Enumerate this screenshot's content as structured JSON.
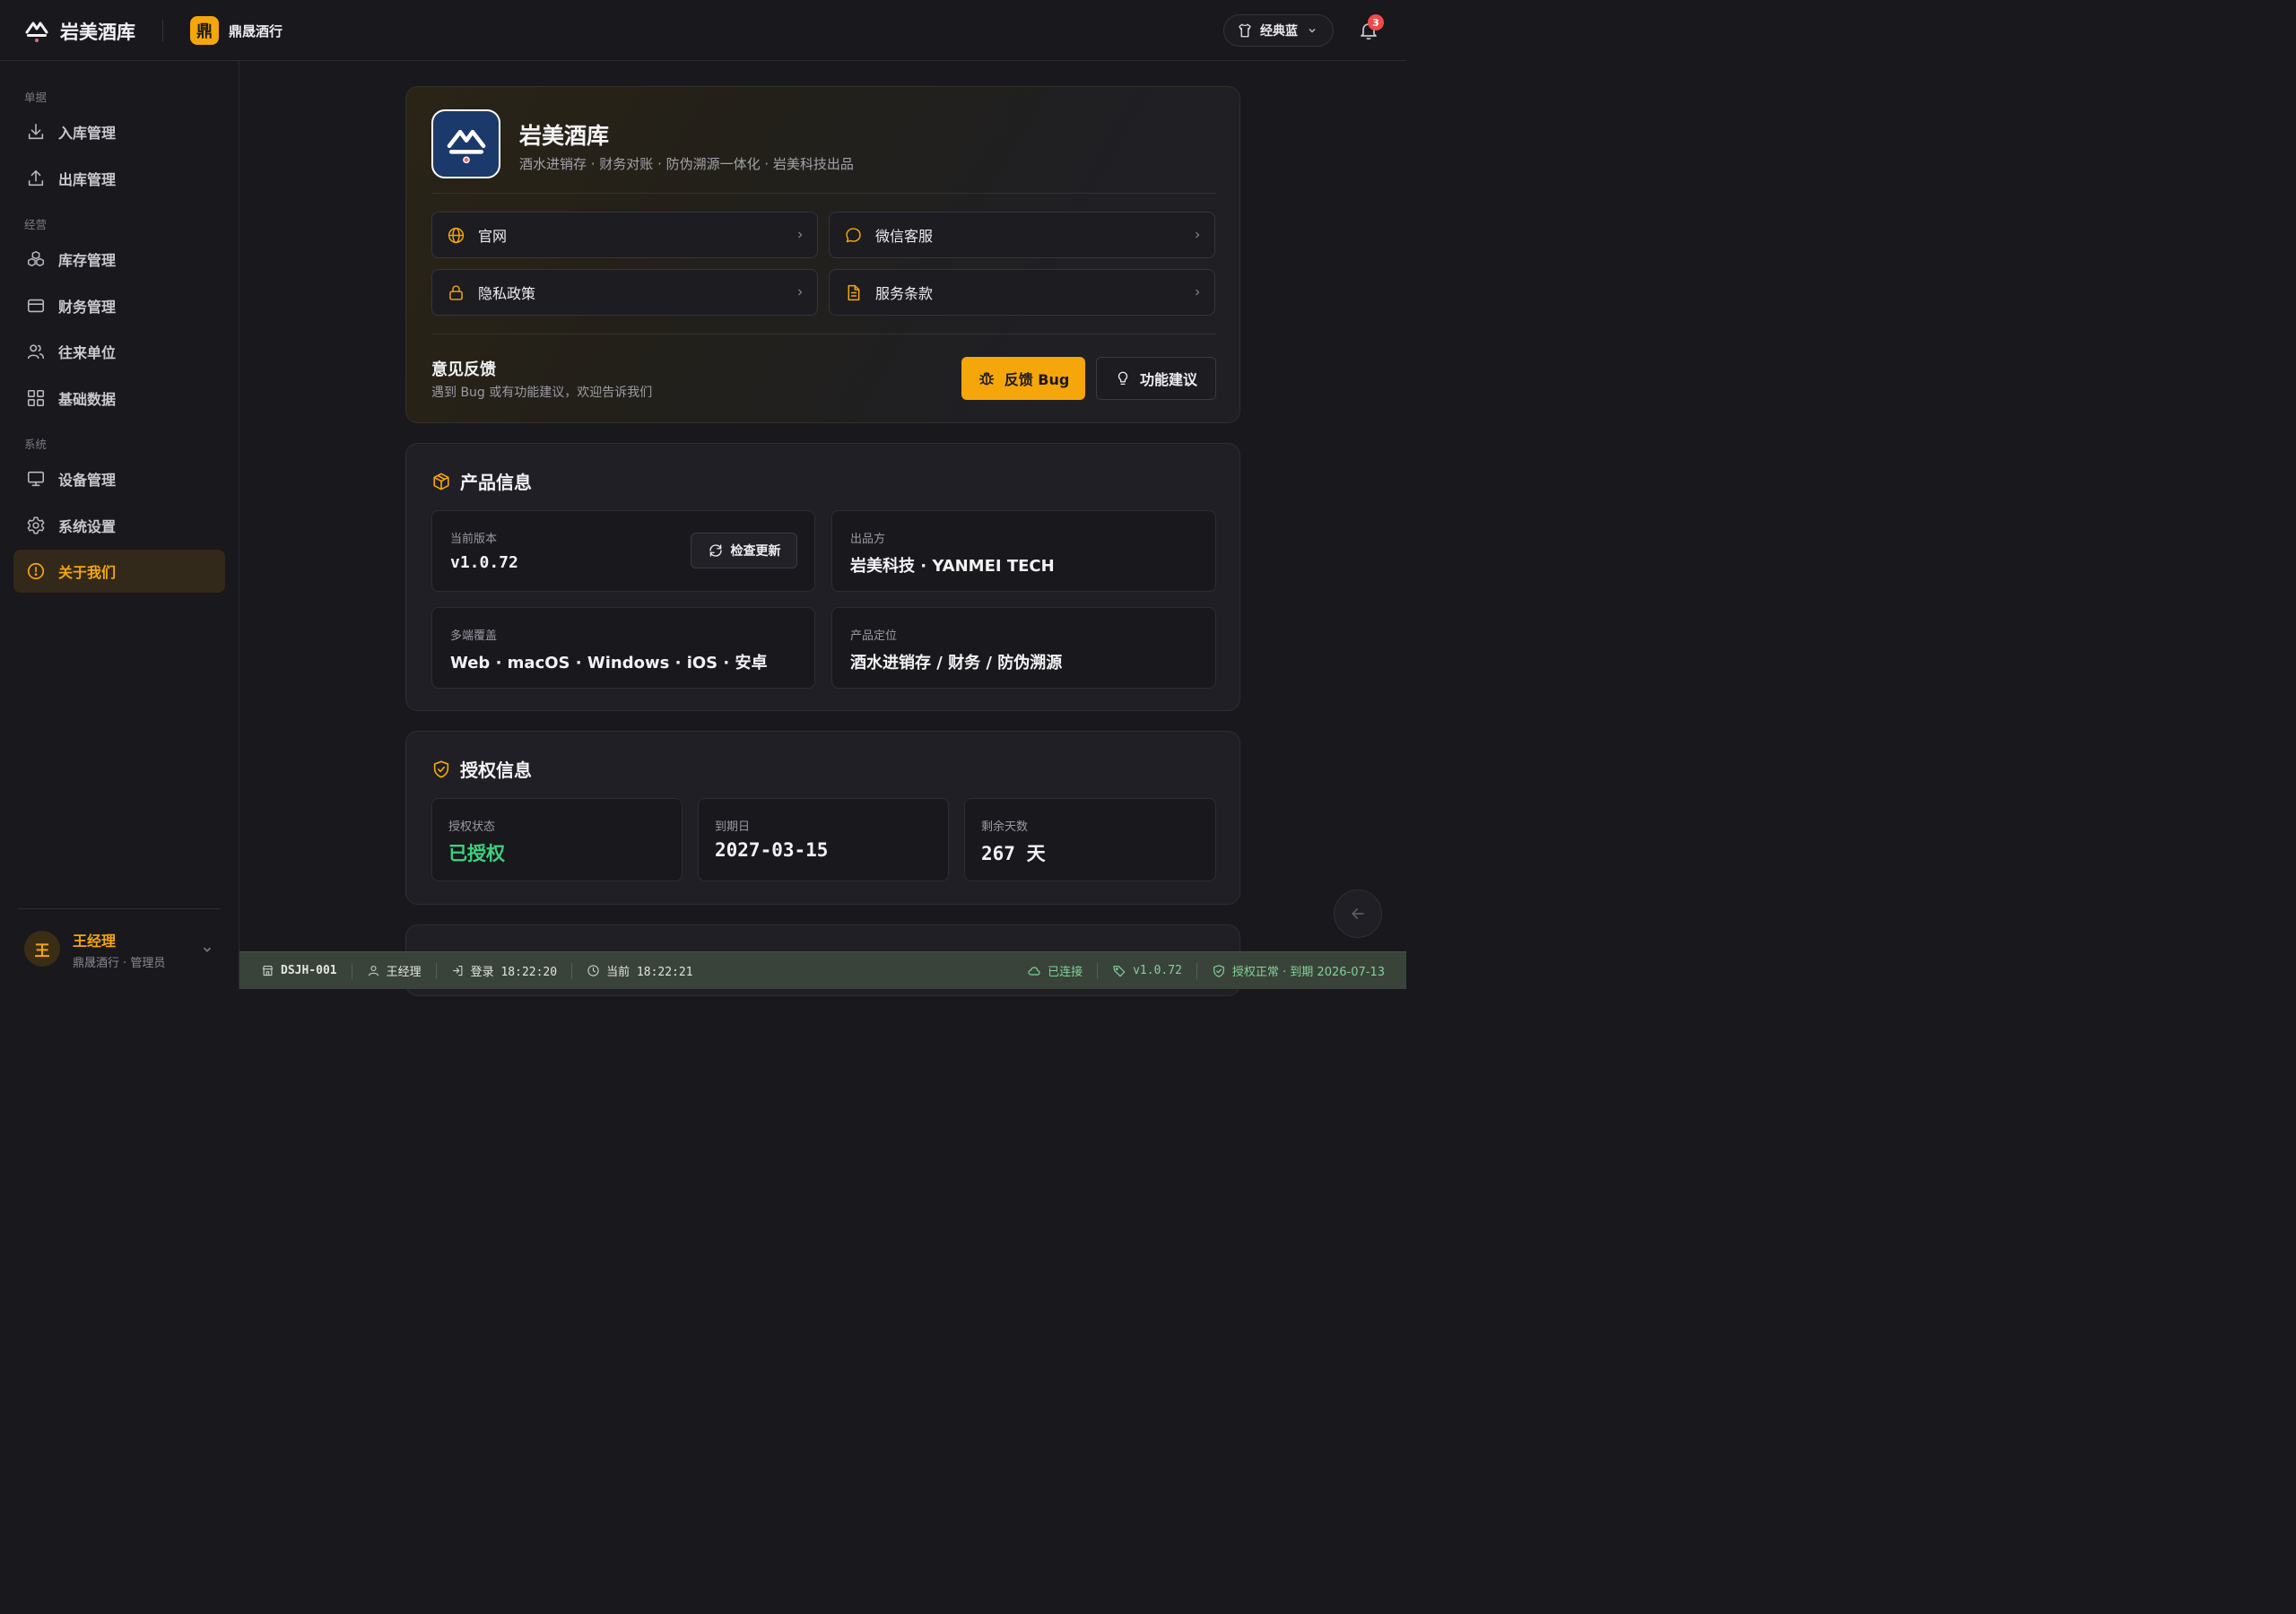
{
  "header": {
    "app_name": "岩美酒库",
    "store_badge": "鼎",
    "store_name": "鼎晟酒行",
    "theme_label": "经典蓝",
    "notifications_count": "3"
  },
  "sidebar": {
    "sections": [
      {
        "title": "单据"
      },
      {
        "title": "经营"
      },
      {
        "title": "系统"
      }
    ],
    "items": [
      {
        "label": "入库管理",
        "icon": "download-icon"
      },
      {
        "label": "出库管理",
        "icon": "upload-icon"
      },
      {
        "label": "库存管理",
        "icon": "boxes-icon"
      },
      {
        "label": "财务管理",
        "icon": "card-icon"
      },
      {
        "label": "往来单位",
        "icon": "users-icon"
      },
      {
        "label": "基础数据",
        "icon": "grid-icon"
      },
      {
        "label": "设备管理",
        "icon": "monitor-icon"
      },
      {
        "label": "系统设置",
        "icon": "gear-icon"
      },
      {
        "label": "关于我们",
        "icon": "info-icon",
        "active": true
      }
    ],
    "user": {
      "avatar": "王",
      "name": "王经理",
      "sub": "鼎晟酒行 · 管理员"
    }
  },
  "hero": {
    "title": "岩美酒库",
    "subtitle": "酒水进销存 · 财务对账 · 防伪溯源一体化 · 岩美科技出品",
    "links": [
      {
        "label": "官网",
        "icon": "globe-icon"
      },
      {
        "label": "微信客服",
        "icon": "chat-icon"
      },
      {
        "label": "隐私政策",
        "icon": "lock-icon"
      },
      {
        "label": "服务条款",
        "icon": "document-icon"
      }
    ],
    "feedback": {
      "title": "意见反馈",
      "subtitle": "遇到 Bug 或有功能建议，欢迎告诉我们",
      "bug_button": "反馈 Bug",
      "idea_button": "功能建议"
    }
  },
  "product": {
    "title": "产品信息",
    "version_label": "当前版本",
    "version_value": "v1.0.72",
    "check_update": "检查更新",
    "publisher_label": "出品方",
    "publisher_value": "岩美科技 · YANMEI TECH",
    "platforms_label": "多端覆盖",
    "platforms_value": "Web · macOS · Windows · iOS · 安卓",
    "positioning_label": "产品定位",
    "positioning_value": "酒水进销存 / 财务 / 防伪溯源"
  },
  "license": {
    "title": "授权信息",
    "status_label": "授权状态",
    "status_value": "已授权",
    "expiry_label": "到期日",
    "expiry_value": "2027-03-15",
    "remaining_label": "剩余天数",
    "remaining_value": "267 天"
  },
  "statusbar": {
    "device": "DSJH-001",
    "user": "王经理",
    "login": "登录 18:22:20",
    "now": "当前 18:22:21",
    "connection": "已连接",
    "version": "v1.0.72",
    "license": "授权正常 · 到期 2026-07-13"
  },
  "colors": {
    "accent": "#f5a60a",
    "success": "#3ecf7d",
    "brand_icon_bg": "#1b3a6b",
    "badge": "#ef4a4a"
  }
}
